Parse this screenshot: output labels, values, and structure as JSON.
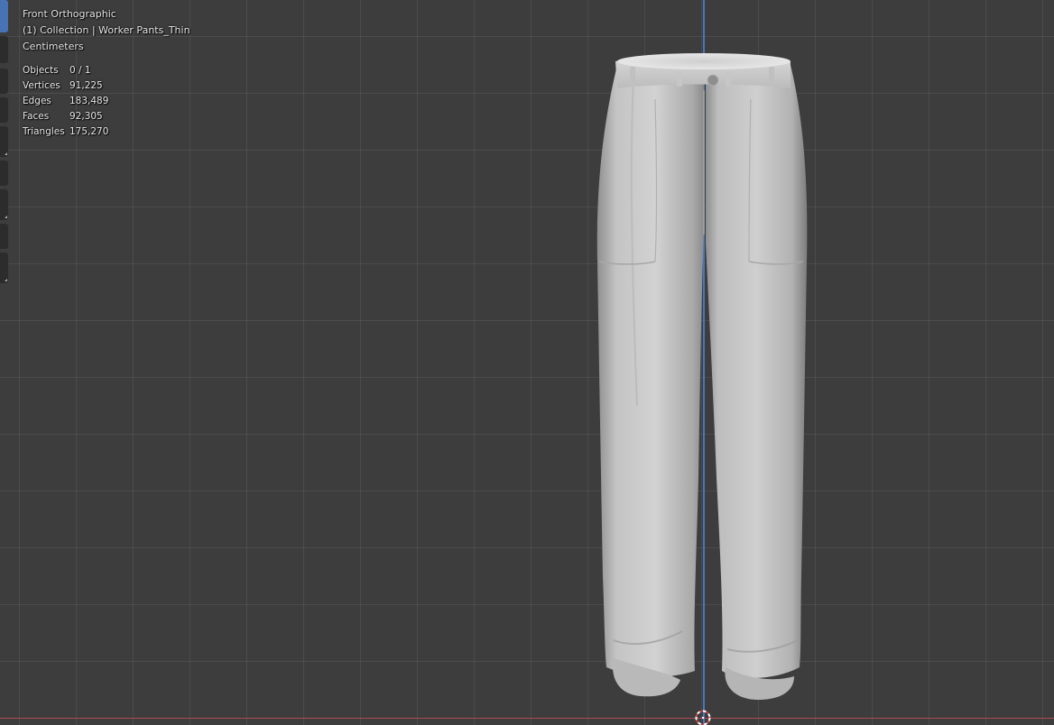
{
  "view": {
    "name": "Front Orthographic",
    "collection": "(1) Collection | Worker Pants_Thin",
    "units": "Centimeters"
  },
  "stats": [
    {
      "label": "Objects",
      "value": "0 / 1"
    },
    {
      "label": "Vertices",
      "value": "91,225"
    },
    {
      "label": "Edges",
      "value": "183,489"
    },
    {
      "label": "Faces",
      "value": "92,305"
    },
    {
      "label": "Triangles",
      "value": "175,270"
    }
  ],
  "model": {
    "description_icon": "pants-mesh"
  },
  "colors": {
    "background": "#3d3d3d",
    "z_axis": "#4a7fd6",
    "x_axis": "#b84a55",
    "active_tool": "#4772b3",
    "mesh": "#c9c9c9"
  }
}
